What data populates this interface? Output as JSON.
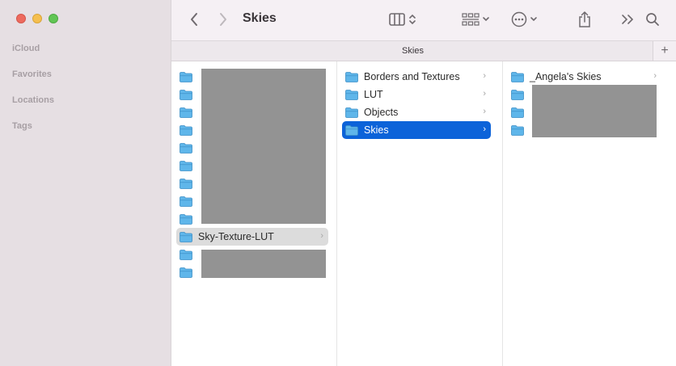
{
  "sidebar": {
    "sections": [
      "iCloud",
      "Favorites",
      "Locations",
      "Tags"
    ]
  },
  "toolbar": {
    "title": "Skies",
    "icons": [
      "back-chevron-icon",
      "forward-chevron-icon",
      "column-view-icon",
      "group-icon",
      "more-actions-icon",
      "share-icon",
      "overflow-icon",
      "search-icon"
    ]
  },
  "tab": {
    "title": "Skies",
    "add_label": "+"
  },
  "columns": {
    "col1": {
      "selected": "Sky-Texture-LUT"
    },
    "col2": {
      "items": [
        "Borders and Textures",
        "LUT",
        "Objects",
        "Skies"
      ],
      "selected": "Skies"
    },
    "col3": {
      "items": [
        "_Angela's Skies"
      ]
    }
  },
  "colors": {
    "selection_blue": "#0c63d9",
    "folder_blue": "#5fb6ea",
    "sidebar_bg": "#e6dfe3"
  }
}
